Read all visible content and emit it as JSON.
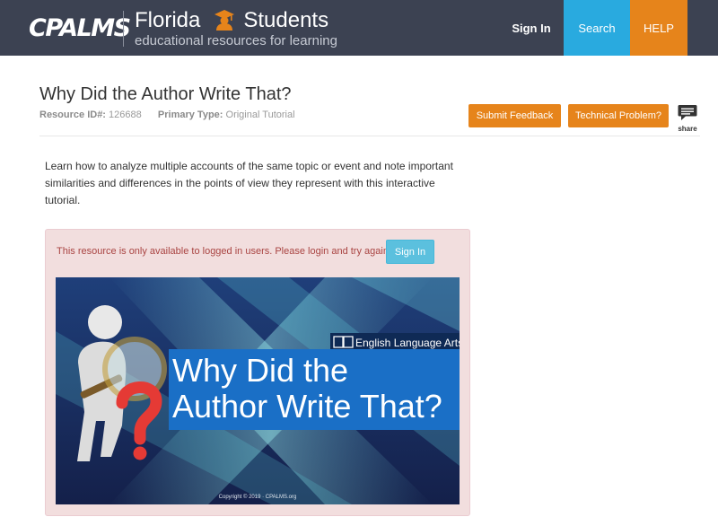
{
  "header": {
    "logo": "CPALMS",
    "title_word1": "Florida",
    "title_word2": "Students",
    "subtitle": "educational resources for learning",
    "nav": {
      "sign_in": "Sign In",
      "search": "Search",
      "help": "HELP"
    }
  },
  "resource": {
    "title": "Why Did the Author Write That?",
    "id_label": "Resource ID#:",
    "id_value": "126688",
    "type_label": "Primary Type:",
    "type_value": "Original Tutorial",
    "buttons": {
      "feedback": "Submit Feedback",
      "technical": "Technical Problem?",
      "share": "share"
    },
    "description": "Learn how to analyze multiple accounts of the same topic or event and note important similarities and differences in the points of view they represent with this interactive tutorial."
  },
  "alert": {
    "message": "This resource is only available to logged in users. Please login and try again.",
    "sign_in": "Sign In"
  },
  "banner": {
    "subject": "English Language Arts",
    "title_line1": "Why Did the",
    "title_line2": "Author Write That?",
    "copyright": "Copyright © 2019 · CPALMS.org"
  },
  "colors": {
    "header_bg": "#3c4252",
    "search_blue": "#29aadf",
    "help_orange": "#e6841b",
    "alert_bg": "#f2dede",
    "banner_blue": "#1a6fc6"
  },
  "icons": [
    "student-icon",
    "share-speech-icon",
    "book-icon",
    "magnifier-figure-icon",
    "question-mark-icon"
  ]
}
